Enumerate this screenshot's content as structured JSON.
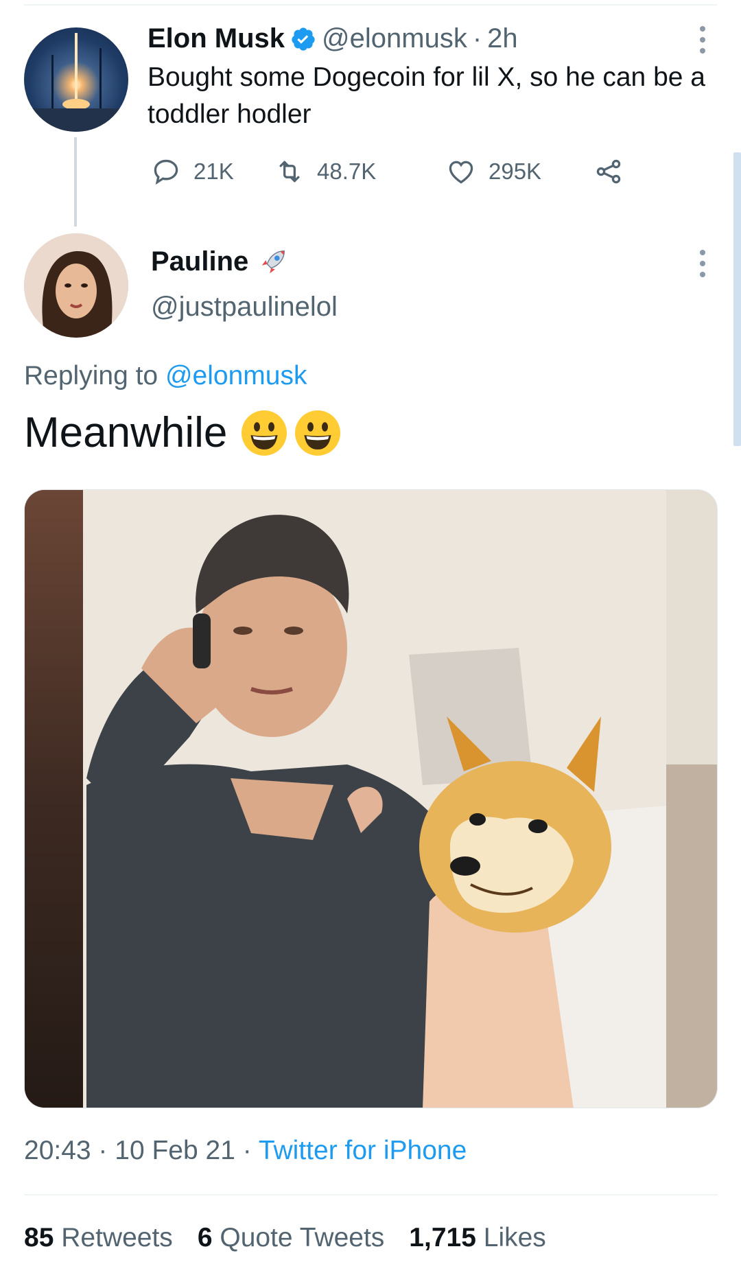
{
  "parent_tweet": {
    "name": "Elon Musk",
    "handle": "@elonmusk",
    "separator": "·",
    "time": "2h",
    "text": "Bought some Dogecoin for lil X, so he can be a toddler hodler",
    "replies": "21K",
    "retweets": "48.7K",
    "likes": "295K"
  },
  "reply_tweet": {
    "name": "Pauline",
    "handle": "@justpaulinelol",
    "replying_prefix": "Replying to",
    "replying_to": "@elonmusk",
    "text": "Meanwhile",
    "timestamp": "20:43 · 10 Feb 21 · ",
    "source": "Twitter for iPhone",
    "stats": {
      "retweets_count": "85",
      "retweets_label": "Retweets",
      "quotes_count": "6",
      "quotes_label": "Quote Tweets",
      "likes_count": "1,715",
      "likes_label": "Likes"
    }
  },
  "icons": [
    "verified-badge-icon",
    "more-options-icon",
    "reply-icon",
    "retweet-icon",
    "like-icon",
    "share-icon",
    "rocket-emoji-icon",
    "grinning-face-emoji-icon"
  ],
  "colors": {
    "accent": "#1d9bf0",
    "muted": "#536471",
    "text": "#0f1419"
  }
}
